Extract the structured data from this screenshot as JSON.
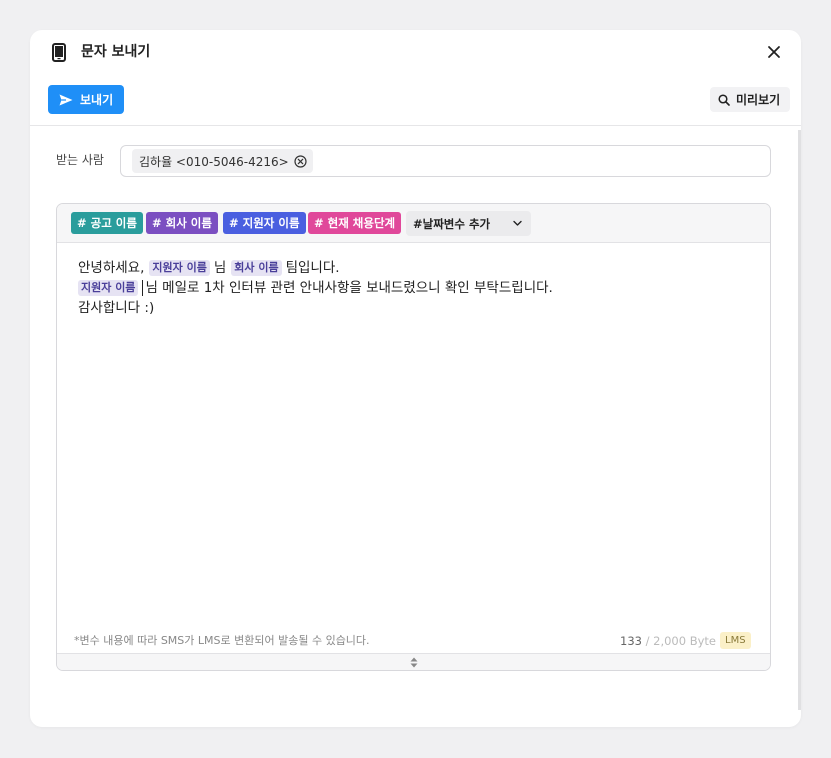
{
  "modal": {
    "title": "문자 보내기",
    "icons": {
      "title": "phone-icon",
      "close": "close-icon"
    }
  },
  "toolbar": {
    "send_label": "보내기",
    "preview_label": "미리보기",
    "icons": {
      "send": "send-icon",
      "preview": "search-icon"
    }
  },
  "recipient": {
    "label": "받는 사람",
    "chips": [
      {
        "text": "김하율 <010-5046-4216>"
      }
    ]
  },
  "editor": {
    "variables": [
      {
        "label": "# 공고 이름",
        "color": "#2a9d9c"
      },
      {
        "label": "# 회사 이름",
        "color": "#7b4fc1"
      },
      {
        "label": "# 지원자 이름",
        "color": "#4a5fe0"
      },
      {
        "label": "# 현재 채용단계",
        "color": "#e0489a"
      }
    ],
    "date_variable_label": "#날짜변수 추가",
    "body": {
      "line1_prefix": "안녕하세요,",
      "tag_applicant": "지원자 이름",
      "line1_mid": "님",
      "tag_company": "회사 이름",
      "line1_suffix": "팀입니다.",
      "line2_tag": "지원자 이름",
      "line2_text": "님 메일로 1차 인터뷰 관련 안내사항을 보내드렸으니 확인 부탁드립니다.",
      "line3_text": "감사합니다 :)"
    },
    "footer_note": "*변수 내용에 따라 SMS가 LMS로 변환되어 발송될 수 있습니다.",
    "byte_count": "133",
    "byte_sep": "/",
    "byte_max": "2,000 Byte",
    "message_type": "LMS"
  },
  "colors": {
    "primary": "#1f8ff7",
    "lms_badge_bg": "#fbf0c8"
  }
}
